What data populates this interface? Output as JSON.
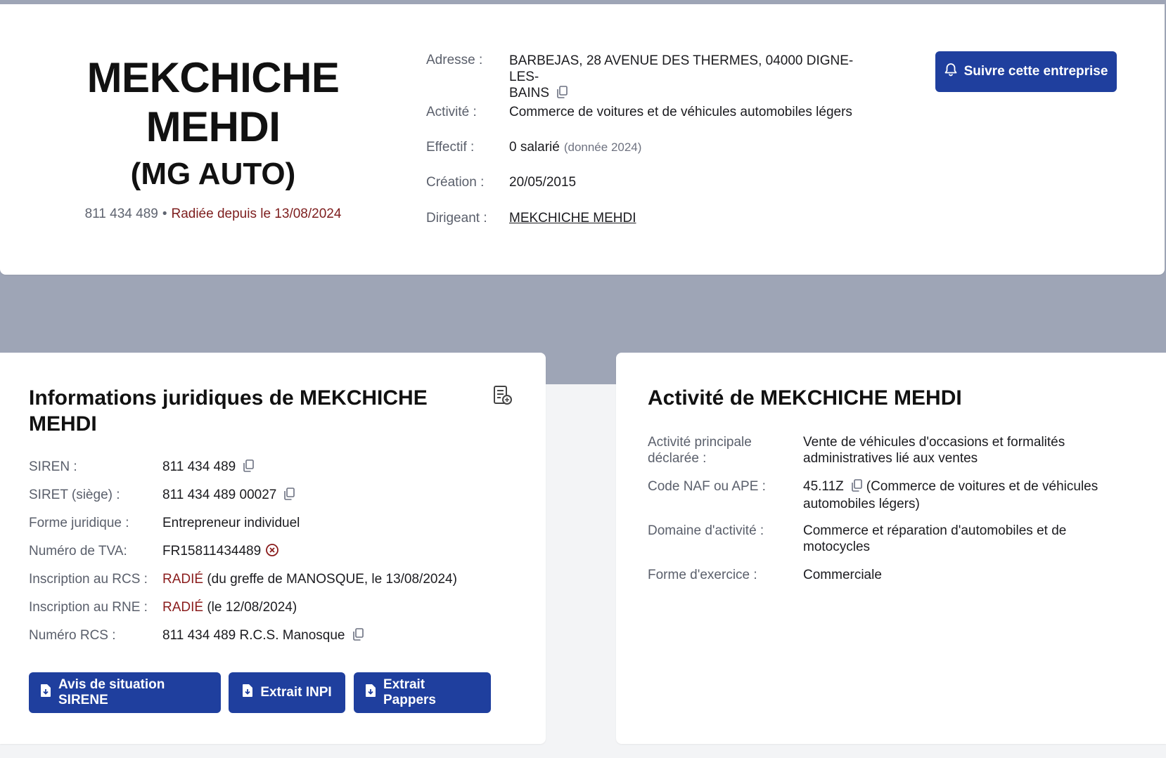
{
  "header": {
    "name_line1": "MEKCHICHE",
    "name_line2": "MEHDI",
    "trade_name": "(MG AUTO)",
    "siren": "811 434 489",
    "separator": "•",
    "status": "Radiée depuis le 13/08/2024",
    "address_label": "Adresse :",
    "address_line1": "BARBEJAS, 28 AVENUE DES THERMES, 04000 DIGNE-LES-",
    "address_line2": "BAINS",
    "activity_label": "Activité :",
    "activity_value": "Commerce de voitures et de véhicules automobiles légers",
    "staff_label": "Effectif :",
    "staff_value": "0 salarié",
    "staff_note": "(donnée 2024)",
    "creation_label": "Création :",
    "creation_value": "20/05/2015",
    "director_label": "Dirigeant :",
    "director_value": "MEKCHICHE MEHDI",
    "follow_button": "Suivre cette entreprise"
  },
  "legal": {
    "title_line1": "Informations juridiques de MEKCHICHE",
    "title_line2": "MEHDI",
    "rows": [
      {
        "label": "SIREN :",
        "value": "811 434 489"
      },
      {
        "label": "SIRET (siège) :",
        "value": "811 434 489 00027"
      },
      {
        "label": "Forme juridique :",
        "value": "Entrepreneur individuel"
      },
      {
        "label": "Numéro de TVA:",
        "value": "FR15811434489"
      },
      {
        "label": "Inscription au RCS :",
        "status": "RADIÉ",
        "value": "(du greffe de MANOSQUE, le 13/08/2024)"
      },
      {
        "label": "Inscription au RNE :",
        "status": "RADIÉ",
        "value": "(le 12/08/2024)"
      },
      {
        "label": "Numéro RCS :",
        "value": "811 434 489 R.C.S. Manosque"
      }
    ],
    "buttons": [
      "Avis de situation SIRENE",
      "Extrait INPI",
      "Extrait Pappers"
    ]
  },
  "activity": {
    "title": "Activité de MEKCHICHE MEHDI",
    "rows": [
      {
        "label1": "Activité principale",
        "label2": "déclarée :",
        "value1": "Vente de véhicules d'occasions et formalités",
        "value2": "administratives lié aux ventes"
      },
      {
        "label1": "Code NAF ou APE :",
        "code": "45.11Z",
        "value1": "(Commerce de voitures et de véhicules",
        "value2": "automobiles légers)"
      },
      {
        "label1": "Domaine d'activité :",
        "value1": "Commerce et réparation d'automobiles et de",
        "value2": "motocycles"
      },
      {
        "label1": "Forme d'exercice :",
        "value1": "Commerciale"
      }
    ]
  },
  "icons": {
    "copy": "copy-icon",
    "bell": "bell-icon",
    "download": "file-download-icon",
    "error": "error-circle-icon",
    "document": "legal-document-icon"
  },
  "colors": {
    "primary": "#1f3f9e",
    "status_red": "#7d1d1d",
    "band": "#9ea5b6"
  }
}
